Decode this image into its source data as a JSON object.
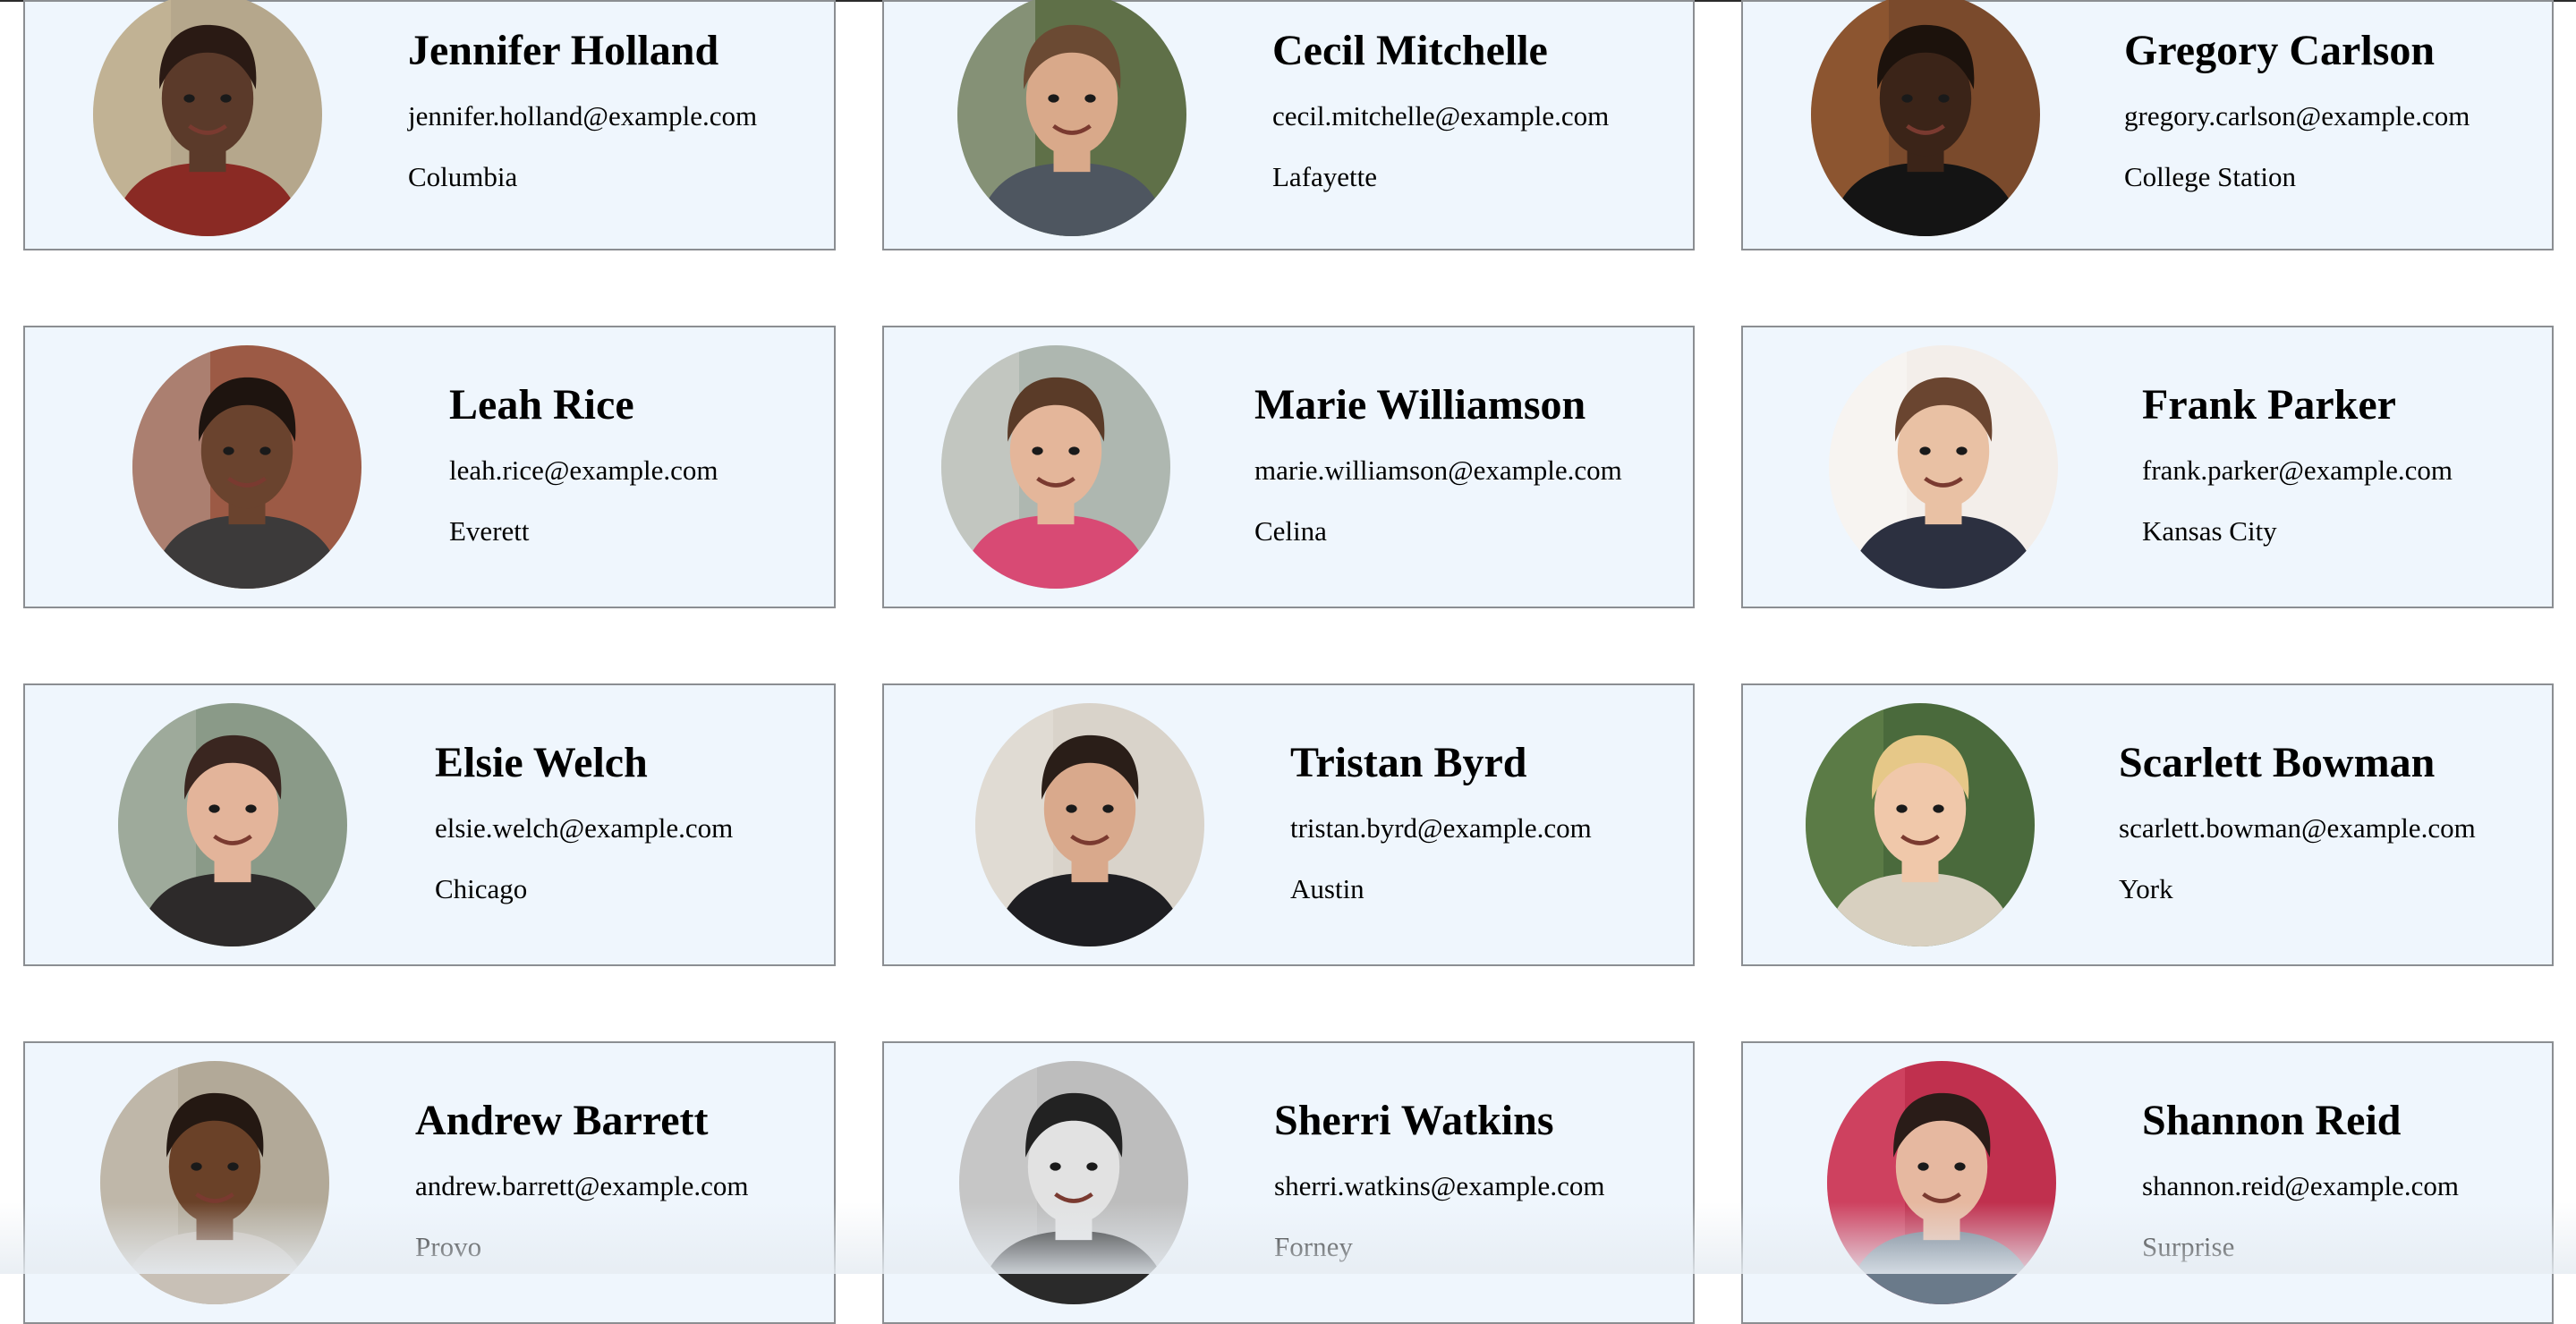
{
  "users": [
    {
      "name": "Jennifer Holland",
      "email": "jennifer.holland@example.com",
      "city": "Columbia",
      "skin": "#5b3a2a",
      "hair": "#2a1a14",
      "bg": "#b5a78c",
      "shirt": "#8a2a24",
      "accent": "#d8c9a4"
    },
    {
      "name": "Cecil Mitchelle",
      "email": "cecil.mitchelle@example.com",
      "city": "Lafayette",
      "skin": "#d9a98a",
      "hair": "#6b4a33",
      "bg": "#5f7048",
      "shirt": "#4e5660",
      "accent": "#cfcfcf"
    },
    {
      "name": "Gregory Carlson",
      "email": "gregory.carlson@example.com",
      "city": "College Station",
      "skin": "#3b2418",
      "hair": "#1c120c",
      "bg": "#7a4a2c",
      "shirt": "#141414",
      "accent": "#b06a3a"
    },
    {
      "name": "Leah Rice",
      "email": "leah.rice@example.com",
      "city": "Everett",
      "skin": "#6a432e",
      "hair": "#1e140f",
      "bg": "#9c5a45",
      "shirt": "#3c3a3a",
      "accent": "#c9c6c0"
    },
    {
      "name": "Marie Williamson",
      "email": "marie.williamson@example.com",
      "city": "Celina",
      "skin": "#e4b69a",
      "hair": "#5a3b28",
      "bg": "#aeb7b0",
      "shirt": "#d84a74",
      "accent": "#e7e2e0"
    },
    {
      "name": "Frank Parker",
      "email": "frank.parker@example.com",
      "city": "Kansas City",
      "skin": "#e9c1a4",
      "hair": "#6a4530",
      "bg": "#f3eeea",
      "shirt": "#2c3040",
      "accent": "#ffffff"
    },
    {
      "name": "Elsie Welch",
      "email": "elsie.welch@example.com",
      "city": "Chicago",
      "skin": "#e3b49a",
      "hair": "#3a2620",
      "bg": "#8a9a88",
      "shirt": "#2d2a2a",
      "accent": "#c4c8c0"
    },
    {
      "name": "Tristan Byrd",
      "email": "tristan.byrd@example.com",
      "city": "Austin",
      "skin": "#d9a98c",
      "hair": "#2a1e18",
      "bg": "#d9d3ca",
      "shirt": "#1e1e22",
      "accent": "#eeeae4"
    },
    {
      "name": "Scarlett Bowman",
      "email": "scarlett.bowman@example.com",
      "city": "York",
      "skin": "#f0c8aa",
      "hair": "#e6c888",
      "bg": "#4a6a3c",
      "shirt": "#d8d0c0",
      "accent": "#7a9a5a"
    },
    {
      "name": "Andrew Barrett",
      "email": "andrew.barrett@example.com",
      "city": "Provo",
      "skin": "#6a4128",
      "hair": "#241812",
      "bg": "#b2a998",
      "shirt": "#c8c0b6",
      "accent": "#d8d2c8"
    },
    {
      "name": "Sherri Watkins",
      "email": "sherri.watkins@example.com",
      "city": "Forney",
      "skin": "#e2e2e2",
      "hair": "#222222",
      "bg": "#bdbdbd",
      "shirt": "#2a2a2a",
      "accent": "#d6d6d6"
    },
    {
      "name": "Shannon Reid",
      "email": "shannon.reid@example.com",
      "city": "Surprise",
      "skin": "#e6b8a0",
      "hair": "#2a1c18",
      "bg": "#c0304e",
      "shirt": "#6a7a8a",
      "accent": "#e86080"
    }
  ]
}
